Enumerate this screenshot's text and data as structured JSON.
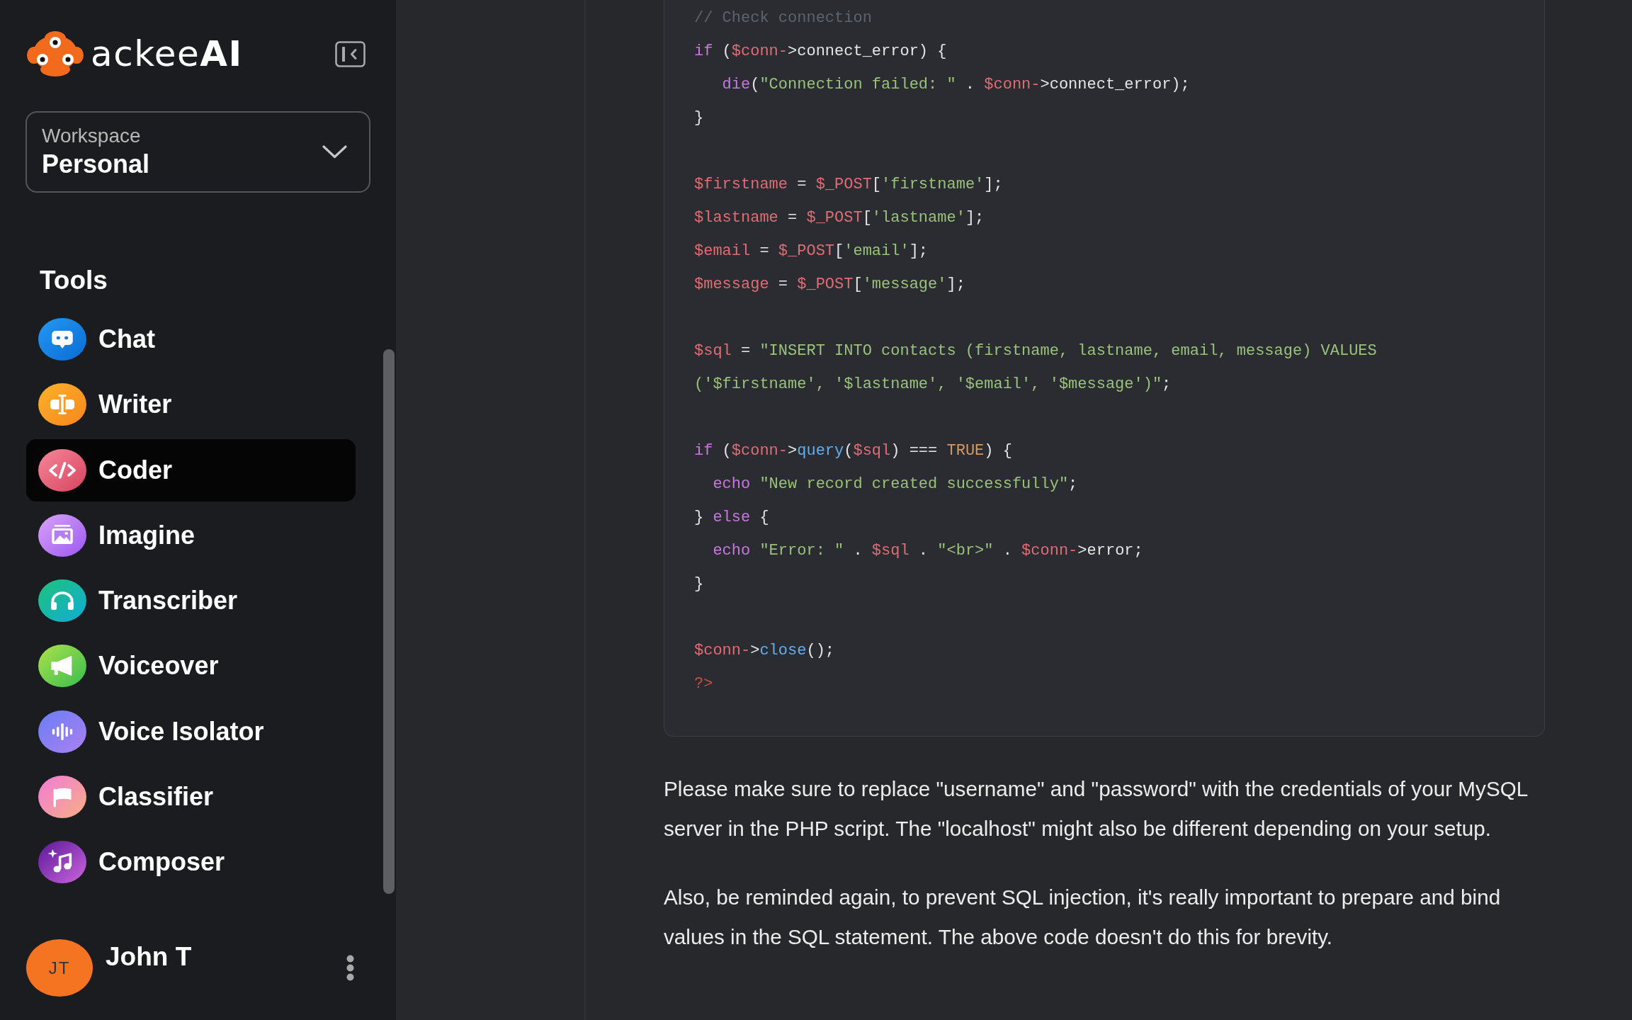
{
  "sidebar": {
    "logo": {
      "wordmark": "ackee**AI**"
    },
    "workspace": {
      "label": "Workspace",
      "value": "Personal"
    },
    "tools": {
      "heading": "Tools",
      "items": [
        {
          "label": "Chat",
          "kind": "chat",
          "selected": false
        },
        {
          "label": "Writer",
          "kind": "writer",
          "selected": false
        },
        {
          "label": "Coder",
          "kind": "coder",
          "selected": true
        },
        {
          "label": "Imagine",
          "kind": "imagine",
          "selected": false
        },
        {
          "label": "Transcriber",
          "kind": "transcriber",
          "selected": false
        },
        {
          "label": "Voiceover",
          "kind": "voiceover",
          "selected": false
        },
        {
          "label": "Voice Isolator",
          "kind": "isolator",
          "selected": false
        },
        {
          "label": "Classifier",
          "kind": "classifier",
          "selected": false
        },
        {
          "label": "Composer",
          "kind": "composer",
          "selected": false
        }
      ]
    },
    "user": {
      "initials": "JT",
      "name": "John T"
    }
  },
  "message": {
    "code": {
      "blocks": [
        [
          [
            {
              "kind": "comment",
              "text": "// Check connection"
            }
          ],
          [
            {
              "kind": "keyword",
              "text": "if"
            },
            {
              "kind": "plain",
              "text": " ("
            },
            {
              "kind": "variable",
              "text": "$conn-"
            },
            {
              "kind": "plain",
              "text": ">connect_error) {"
            }
          ],
          [
            {
              "kind": "keyword",
              "text": "   die"
            },
            {
              "kind": "plain",
              "text": "("
            },
            {
              "kind": "string",
              "text": "\"Connection failed: \""
            },
            {
              "kind": "plain",
              "text": " . "
            },
            {
              "kind": "variable",
              "text": "$conn-"
            },
            {
              "kind": "plain",
              "text": ">connect_error);"
            }
          ],
          [
            {
              "kind": "plain",
              "text": "}"
            }
          ]
        ],
        [
          [
            {
              "kind": "variable",
              "text": "$firstname"
            },
            {
              "kind": "plain",
              "text": " = "
            },
            {
              "kind": "variable",
              "text": "$_POST"
            },
            {
              "kind": "plain",
              "text": "["
            },
            {
              "kind": "string",
              "text": "'firstname'"
            },
            {
              "kind": "plain",
              "text": "];"
            }
          ],
          [
            {
              "kind": "variable",
              "text": "$lastname"
            },
            {
              "kind": "plain",
              "text": " = "
            },
            {
              "kind": "variable",
              "text": "$_POST"
            },
            {
              "kind": "plain",
              "text": "["
            },
            {
              "kind": "string",
              "text": "'lastname'"
            },
            {
              "kind": "plain",
              "text": "];"
            }
          ],
          [
            {
              "kind": "variable",
              "text": "$email"
            },
            {
              "kind": "plain",
              "text": " = "
            },
            {
              "kind": "variable",
              "text": "$_POST"
            },
            {
              "kind": "plain",
              "text": "["
            },
            {
              "kind": "string",
              "text": "'email'"
            },
            {
              "kind": "plain",
              "text": "];"
            }
          ],
          [
            {
              "kind": "variable",
              "text": "$message"
            },
            {
              "kind": "plain",
              "text": " = "
            },
            {
              "kind": "variable",
              "text": "$_POST"
            },
            {
              "kind": "plain",
              "text": "["
            },
            {
              "kind": "string",
              "text": "'message'"
            },
            {
              "kind": "plain",
              "text": "];"
            }
          ]
        ],
        [
          [
            {
              "kind": "variable",
              "text": "$sql"
            },
            {
              "kind": "plain",
              "text": " = "
            },
            {
              "kind": "string",
              "text": "\"INSERT INTO contacts (firstname, lastname, email, message) VALUES"
            }
          ],
          [
            {
              "kind": "string",
              "text": "('$firstname', '$lastname', '$email', '$message')\""
            },
            {
              "kind": "plain",
              "text": ";"
            }
          ]
        ],
        [
          [
            {
              "kind": "keyword",
              "text": "if"
            },
            {
              "kind": "plain",
              "text": " ("
            },
            {
              "kind": "variable",
              "text": "$conn-"
            },
            {
              "kind": "plain",
              "text": ">"
            },
            {
              "kind": "function",
              "text": "query"
            },
            {
              "kind": "plain",
              "text": "("
            },
            {
              "kind": "variable",
              "text": "$sql"
            },
            {
              "kind": "plain",
              "text": ") === "
            },
            {
              "kind": "constant",
              "text": "TRUE"
            },
            {
              "kind": "plain",
              "text": ") {"
            }
          ],
          [
            {
              "kind": "keyword",
              "text": "  echo"
            },
            {
              "kind": "string",
              "text": " \"New record created successfully\""
            },
            {
              "kind": "plain",
              "text": ";"
            }
          ],
          [
            {
              "kind": "plain",
              "text": "} "
            },
            {
              "kind": "keyword",
              "text": "else"
            },
            {
              "kind": "plain",
              "text": " {"
            }
          ],
          [
            {
              "kind": "keyword",
              "text": "  echo"
            },
            {
              "kind": "string",
              "text": " \"Error: \""
            },
            {
              "kind": "plain",
              "text": " . "
            },
            {
              "kind": "variable",
              "text": "$sql"
            },
            {
              "kind": "plain",
              "text": " . "
            },
            {
              "kind": "string",
              "text": "\"<br>\""
            },
            {
              "kind": "plain",
              "text": " . "
            },
            {
              "kind": "variable",
              "text": "$conn-"
            },
            {
              "kind": "plain",
              "text": ">error;"
            }
          ],
          [
            {
              "kind": "plain",
              "text": "}"
            }
          ]
        ],
        [
          [
            {
              "kind": "variable",
              "text": "$conn-"
            },
            {
              "kind": "plain",
              "text": ">"
            },
            {
              "kind": "function",
              "text": "close"
            },
            {
              "kind": "plain",
              "text": "();"
            }
          ],
          [
            {
              "kind": "tag",
              "text": "?>"
            }
          ]
        ]
      ]
    },
    "paragraphs": [
      "Please make sure to replace \"username\" and \"password\" with the credentials of your MySQL server in the PHP script. The \"localhost\" might also be different depending on your setup.",
      "Also, be reminded again, to prevent SQL injection, it's really important to prepare and bind values in the SQL statement. The above code doesn't do this for brevity."
    ]
  }
}
